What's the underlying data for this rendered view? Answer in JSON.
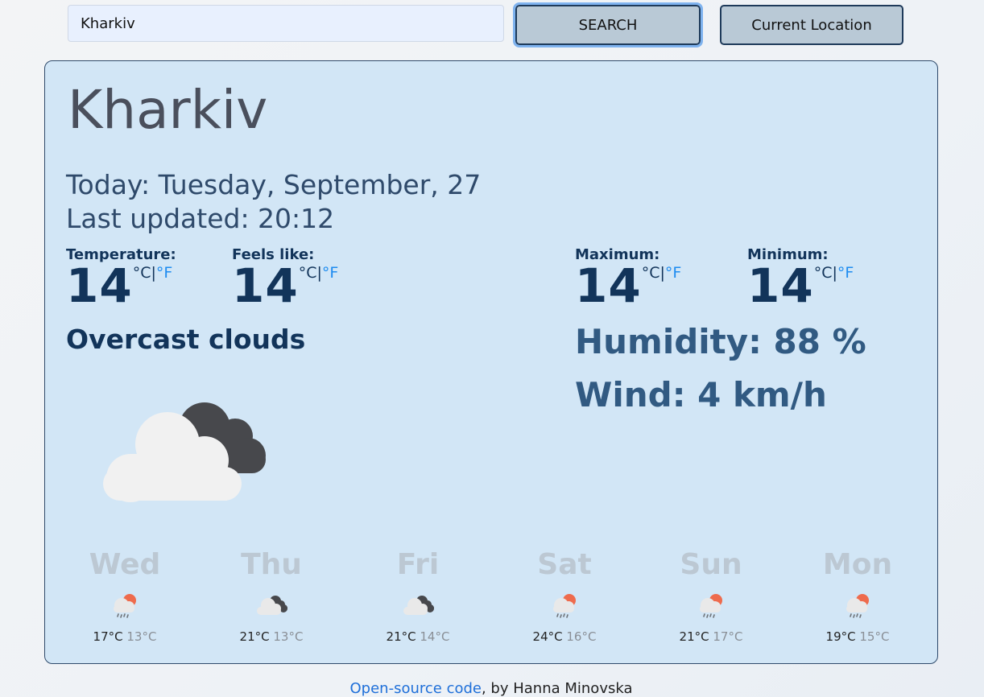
{
  "search": {
    "value": "Kharkiv",
    "button_label": "SEARCH"
  },
  "location_button_label": "Current Location",
  "weather": {
    "city": "Kharkiv",
    "today": "Today: Tuesday, September, 27",
    "last_updated": "Last updated: 20:12",
    "unit_celsius": "°C",
    "unit_sep": "|",
    "unit_fahrenheit": "°F",
    "temperature": {
      "label": "Temperature:",
      "value": "14"
    },
    "feels_like": {
      "label": "Feels like:",
      "value": "14"
    },
    "maximum": {
      "label": "Maximum:",
      "value": "14"
    },
    "minimum": {
      "label": "Minimum:",
      "value": "14"
    },
    "description": "Overcast clouds",
    "humidity": "Humidity: 88 %",
    "wind": "Wind: 4 km/h",
    "main_icon": "overcast-clouds-icon"
  },
  "forecast": [
    {
      "day": "Wed",
      "icon": "rain-sun-icon",
      "hi": "17°C",
      "lo": "13°C"
    },
    {
      "day": "Thu",
      "icon": "broken-clouds-icon",
      "hi": "21°C",
      "lo": "13°C"
    },
    {
      "day": "Fri",
      "icon": "broken-clouds-icon",
      "hi": "21°C",
      "lo": "14°C"
    },
    {
      "day": "Sat",
      "icon": "rain-sun-icon",
      "hi": "24°C",
      "lo": "16°C"
    },
    {
      "day": "Sun",
      "icon": "rain-sun-icon",
      "hi": "21°C",
      "lo": "17°C"
    },
    {
      "day": "Mon",
      "icon": "rain-sun-icon",
      "hi": "19°C",
      "lo": "15°C"
    }
  ],
  "footer": {
    "link_text": "Open-source code",
    "rest": ", by Hanna Minovska"
  },
  "colors": {
    "card_bg": "#d2e6f6",
    "accent": "#1e8cf0",
    "dark_text": "#12345a",
    "button_bg": "#b9c9d6"
  }
}
